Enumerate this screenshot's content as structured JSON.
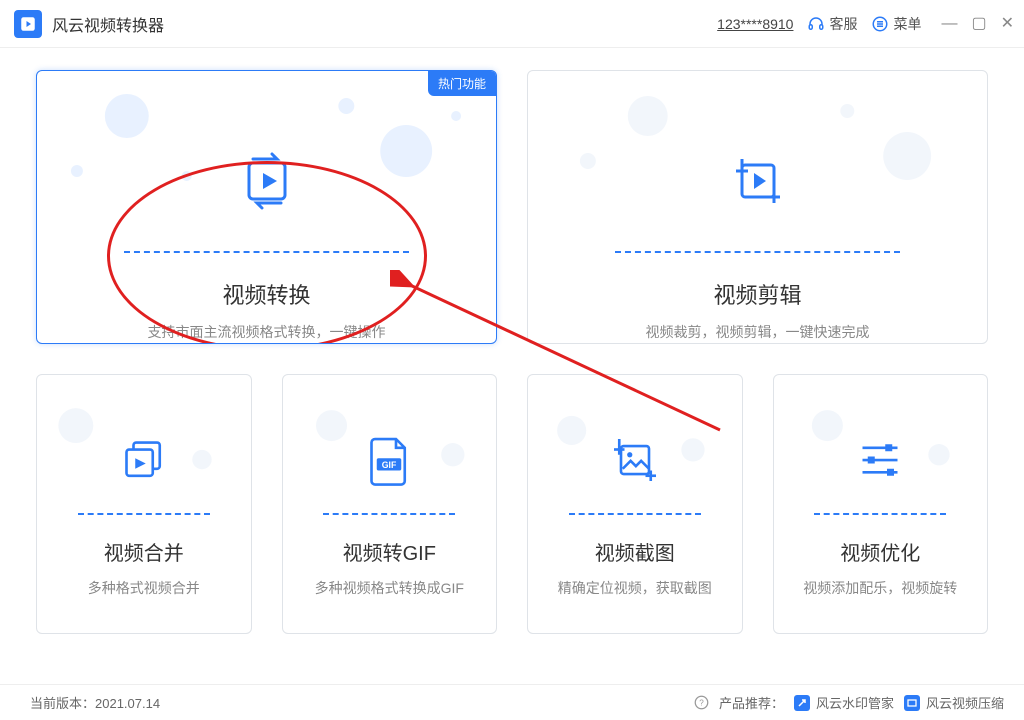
{
  "app_title": "风云视频转换器",
  "account_masked": "123****8910",
  "support_label": "客服",
  "menu_label": "菜单",
  "badge_hot": "热门功能",
  "cards": {
    "convert": {
      "title": "视频转换",
      "desc": "支持市面主流视频格式转换，一键操作"
    },
    "edit": {
      "title": "视频剪辑",
      "desc": "视频裁剪，视频剪辑，一键快速完成"
    },
    "merge": {
      "title": "视频合并",
      "desc": "多种格式视频合并"
    },
    "gif": {
      "title": "视频转GIF",
      "desc": "多种视频格式转换成GIF",
      "gif_tag": "GIF"
    },
    "shot": {
      "title": "视频截图",
      "desc": "精确定位视频，获取截图"
    },
    "opt": {
      "title": "视频优化",
      "desc": "视频添加配乐，视频旋转"
    }
  },
  "footer": {
    "version_label": "当前版本：",
    "version_value": "2021.07.14",
    "recommend_label": "产品推荐：",
    "rec1": "风云水印管家",
    "rec2": "风云视频压缩"
  }
}
